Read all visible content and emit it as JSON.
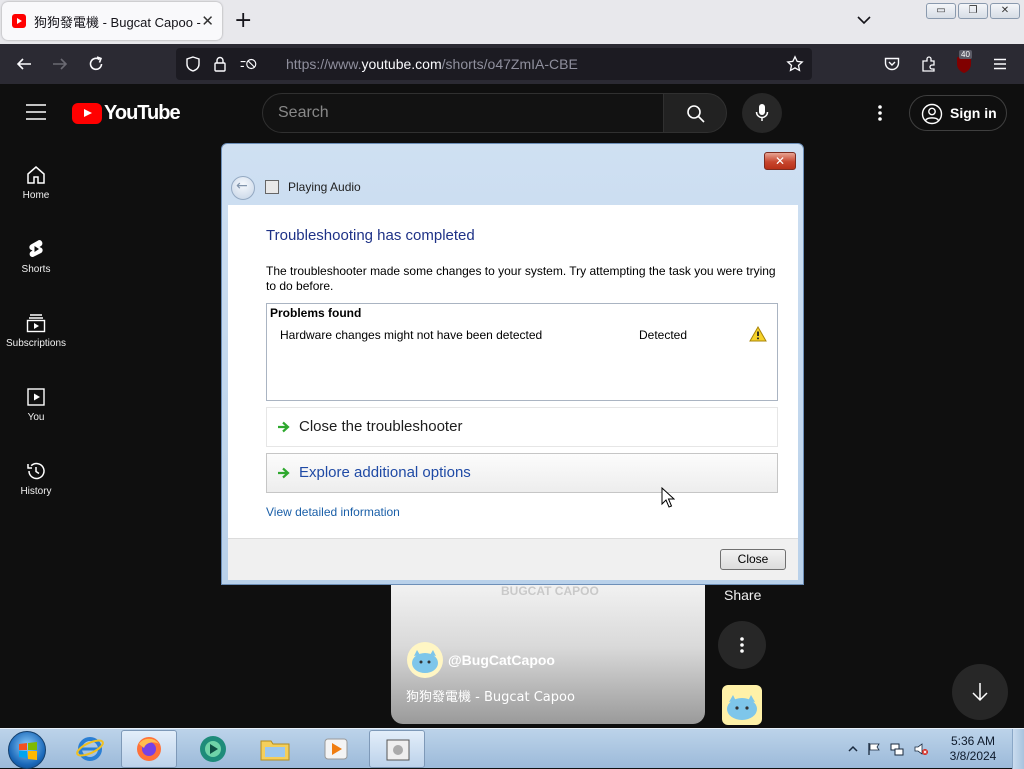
{
  "browser": {
    "tab_title": "狗狗發電機 - Bugcat Capoo - YouTube",
    "tab_close": "✕",
    "new_tab": "+",
    "url_prefix": "https://www.",
    "url_host": "youtube.com",
    "url_path": "/shorts/o47ZmIA-CBE",
    "extension_badge": "40"
  },
  "youtube": {
    "logo_text": "YouTube",
    "search_placeholder": "Search",
    "sign_in": "Sign in",
    "sidebar": [
      {
        "label": "Home",
        "icon": "home-icon"
      },
      {
        "label": "Shorts",
        "icon": "shorts-icon"
      },
      {
        "label": "Subscriptions",
        "icon": "subscriptions-icon"
      },
      {
        "label": "You",
        "icon": "you-icon"
      },
      {
        "label": "History",
        "icon": "history-icon"
      }
    ],
    "short": {
      "watermark": "BUGCAT CAPOO",
      "channel": "@BugCatCapoo",
      "title": "狗狗發電機 - Bugcat Capoo",
      "share_label": "Share"
    }
  },
  "dialog": {
    "breadcrumb": "Playing Audio",
    "heading": "Troubleshooting has completed",
    "description": "The troubleshooter made some changes to your system. Try attempting the task you were trying to do before.",
    "problems_header": "Problems found",
    "problems": [
      {
        "name": "Hardware changes might not have been detected",
        "status": "Detected"
      }
    ],
    "options": [
      "Close the troubleshooter",
      "Explore additional options"
    ],
    "details_link": "View detailed information",
    "close_button": "Close"
  },
  "taskbar": {
    "time": "5:36 AM",
    "date": "3/8/2024"
  },
  "colors": {
    "yt_red": "#ff0000",
    "dialog_heading": "#1e3287",
    "link": "#1a5fa8",
    "option_arrow": "#2ea82e"
  }
}
